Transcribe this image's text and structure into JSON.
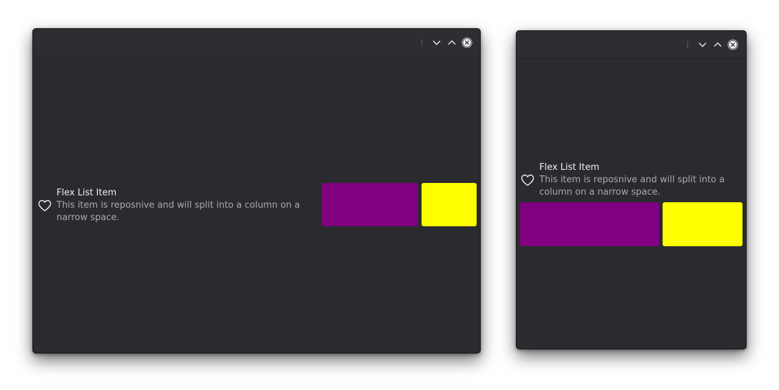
{
  "windows": [
    {
      "item": {
        "title": "Flex List Item",
        "subtitle_line1": "This item is reposnive and will split into a column on a",
        "subtitle_line2": "narrow space."
      }
    },
    {
      "item": {
        "title": "Flex List Item",
        "subtitle_line1": "This item is reposnive and will split into a",
        "subtitle_line2": "column on a narrow space."
      }
    }
  ],
  "icons": {
    "heart": "heart-icon",
    "minimize": "chevron-down-icon",
    "maximize": "chevron-up-icon",
    "close": "close-icon"
  },
  "colors": {
    "window_bg": "#2a2b2e",
    "swatch_purple": "#800080",
    "swatch_yellow": "#ffff00"
  }
}
